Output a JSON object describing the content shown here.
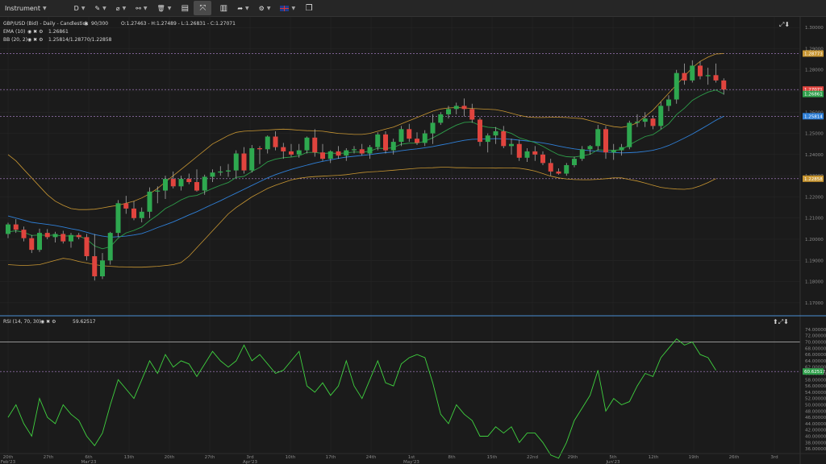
{
  "toolbar": {
    "instrument_label": "Instrument",
    "timeframe": "D",
    "flag_icon": "uk-flag-icon"
  },
  "legend": {
    "title": "GBP/USD (Bid) - Daily - Candlestick",
    "bars": "90/300",
    "ohlc": "O:1.27463 - H:1.27489 - L:1.26831 - C:1.27071",
    "ema_label": "EMA (10)",
    "ema_value": "1.26861",
    "bb_label": "BB (20, 2)",
    "bb_value": "1.25814/1.28770/1.22858"
  },
  "rsi_legend": {
    "label": "RSI (14, 70, 30)",
    "value": "59.62517"
  },
  "price_axis": {
    "ticks": [
      "1.30000",
      "1.29000",
      "1.28000",
      "1.27000",
      "1.26000",
      "1.25000",
      "1.24000",
      "1.23000",
      "1.22000",
      "1.21000",
      "1.20000",
      "1.19000",
      "1.18000",
      "1.17000"
    ],
    "badges": [
      {
        "label": "1.28773",
        "color": "#c89632"
      },
      {
        "label": "1.27071",
        "color": "#e0443e"
      },
      {
        "label": "1.26861",
        "color": "#2e9e4a"
      },
      {
        "label": "1.25814",
        "color": "#2f7fd6"
      },
      {
        "label": "1.22858",
        "color": "#c89632"
      }
    ]
  },
  "rsi_axis": {
    "ticks": [
      "74.00000",
      "72.00000",
      "70.00000",
      "68.00000",
      "66.00000",
      "64.00000",
      "62.00000",
      "60.00000",
      "58.00000",
      "56.00000",
      "54.00000",
      "52.00000",
      "50.00000",
      "48.00000",
      "46.00000",
      "44.00000",
      "42.00000",
      "40.00000",
      "38.00000",
      "36.00000"
    ],
    "badge": {
      "label": "60.62517",
      "color": "#2e9e4a"
    }
  },
  "dates": [
    {
      "label": "20th",
      "sub": "Feb'23"
    },
    {
      "label": "27th",
      "sub": ""
    },
    {
      "label": "6th",
      "sub": "Mar'23"
    },
    {
      "label": "13th",
      "sub": ""
    },
    {
      "label": "20th",
      "sub": ""
    },
    {
      "label": "27th",
      "sub": ""
    },
    {
      "label": "3rd",
      "sub": "Apr'23"
    },
    {
      "label": "10th",
      "sub": ""
    },
    {
      "label": "17th",
      "sub": ""
    },
    {
      "label": "24th",
      "sub": ""
    },
    {
      "label": "1st",
      "sub": "May'23"
    },
    {
      "label": "8th",
      "sub": ""
    },
    {
      "label": "15th",
      "sub": ""
    },
    {
      "label": "22nd",
      "sub": ""
    },
    {
      "label": "29th",
      "sub": ""
    },
    {
      "label": "5th",
      "sub": "Jun'23"
    },
    {
      "label": "12th",
      "sub": ""
    },
    {
      "label": "19th",
      "sub": ""
    },
    {
      "label": "26th",
      "sub": ""
    },
    {
      "label": "3rd",
      "sub": ""
    }
  ],
  "colors": {
    "up": "#2ea84f",
    "down": "#e0443e",
    "ema": "#2e9e4a",
    "bb_mid": "#2f7fd6",
    "bb_band": "#c89632",
    "rsi": "#3fd13f",
    "bg": "#1b1b1b"
  },
  "chart_data": {
    "type": "candlestick",
    "title": "GBP/USD (Bid) - Daily - Candlestick",
    "ylim": [
      1.165,
      1.305
    ],
    "candles": [
      [
        1.2025,
        1.2078,
        1.2005,
        1.207
      ],
      [
        1.207,
        1.2095,
        1.203,
        1.2045
      ],
      [
        1.2045,
        1.206,
        1.199,
        1.2005
      ],
      [
        1.2005,
        1.202,
        1.1935,
        1.195
      ],
      [
        1.195,
        1.205,
        1.194,
        1.203
      ],
      [
        1.203,
        1.2048,
        1.2,
        1.201
      ],
      [
        1.201,
        1.2035,
        1.1985,
        1.2025
      ],
      [
        1.2025,
        1.204,
        1.198,
        1.199
      ],
      [
        1.199,
        1.203,
        1.196,
        1.202
      ],
      [
        1.202,
        1.203,
        1.2,
        1.201
      ],
      [
        1.201,
        1.2025,
        1.19,
        1.192
      ],
      [
        1.192,
        1.2025,
        1.1805,
        1.1825
      ],
      [
        1.1825,
        1.1935,
        1.1812,
        1.19
      ],
      [
        1.19,
        1.2035,
        1.188,
        1.203
      ],
      [
        1.203,
        1.2185,
        1.201,
        1.217
      ],
      [
        1.217,
        1.2205,
        1.212,
        1.2145
      ],
      [
        1.2145,
        1.218,
        1.209,
        1.21
      ],
      [
        1.21,
        1.215,
        1.208,
        1.213
      ],
      [
        1.213,
        1.2245,
        1.21,
        1.2225
      ],
      [
        1.2225,
        1.225,
        1.217,
        1.223
      ],
      [
        1.223,
        1.23,
        1.219,
        1.2285
      ],
      [
        1.2285,
        1.232,
        1.224,
        1.225
      ],
      [
        1.225,
        1.23,
        1.223,
        1.2285
      ],
      [
        1.2285,
        1.231,
        1.226,
        1.227
      ],
      [
        1.227,
        1.233,
        1.2225,
        1.223
      ],
      [
        1.223,
        1.2305,
        1.221,
        1.2295
      ],
      [
        1.2295,
        1.233,
        1.227,
        1.2315
      ],
      [
        1.2315,
        1.2345,
        1.23,
        1.232
      ],
      [
        1.232,
        1.2355,
        1.2295,
        1.2325
      ],
      [
        1.2325,
        1.242,
        1.229,
        1.2405
      ],
      [
        1.2405,
        1.2435,
        1.231,
        1.2325
      ],
      [
        1.2325,
        1.2445,
        1.2315,
        1.243
      ],
      [
        1.243,
        1.244,
        1.2355,
        1.2425
      ],
      [
        1.2425,
        1.249,
        1.2405,
        1.2485
      ],
      [
        1.2485,
        1.251,
        1.242,
        1.2435
      ],
      [
        1.2435,
        1.2455,
        1.238,
        1.2415
      ],
      [
        1.2415,
        1.245,
        1.239,
        1.24
      ],
      [
        1.24,
        1.245,
        1.2385,
        1.242
      ],
      [
        1.242,
        1.2485,
        1.2405,
        1.248
      ],
      [
        1.248,
        1.252,
        1.239,
        1.241
      ],
      [
        1.241,
        1.245,
        1.237,
        1.238
      ],
      [
        1.238,
        1.242,
        1.236,
        1.2415
      ],
      [
        1.2415,
        1.244,
        1.238,
        1.2395
      ],
      [
        1.2395,
        1.243,
        1.237,
        1.242
      ],
      [
        1.242,
        1.244,
        1.2405,
        1.2425
      ],
      [
        1.2425,
        1.245,
        1.2395,
        1.2405
      ],
      [
        1.2405,
        1.2445,
        1.238,
        1.2435
      ],
      [
        1.2435,
        1.2505,
        1.242,
        1.2495
      ],
      [
        1.2495,
        1.251,
        1.2405,
        1.242
      ],
      [
        1.242,
        1.2475,
        1.24,
        1.246
      ],
      [
        1.246,
        1.2535,
        1.244,
        1.252
      ],
      [
        1.252,
        1.2545,
        1.246,
        1.2475
      ],
      [
        1.2475,
        1.2505,
        1.2445,
        1.2455
      ],
      [
        1.2455,
        1.2515,
        1.244,
        1.25
      ],
      [
        1.25,
        1.259,
        1.245,
        1.255
      ],
      [
        1.255,
        1.26,
        1.254,
        1.259
      ],
      [
        1.259,
        1.263,
        1.257,
        1.2615
      ],
      [
        1.2615,
        1.2645,
        1.259,
        1.263
      ],
      [
        1.263,
        1.2665,
        1.258,
        1.2615
      ],
      [
        1.2615,
        1.264,
        1.255,
        1.2565
      ],
      [
        1.2565,
        1.2575,
        1.244,
        1.246
      ],
      [
        1.246,
        1.25,
        1.241,
        1.249
      ],
      [
        1.249,
        1.253,
        1.245,
        1.251
      ],
      [
        1.251,
        1.2535,
        1.243,
        1.244
      ],
      [
        1.244,
        1.2475,
        1.24,
        1.245
      ],
      [
        1.245,
        1.247,
        1.237,
        1.2385
      ],
      [
        1.2385,
        1.243,
        1.2365,
        1.2415
      ],
      [
        1.2415,
        1.244,
        1.237,
        1.24
      ],
      [
        1.24,
        1.2415,
        1.235,
        1.236
      ],
      [
        1.236,
        1.238,
        1.23,
        1.232
      ],
      [
        1.232,
        1.2335,
        1.2305,
        1.231
      ],
      [
        1.231,
        1.236,
        1.23,
        1.235
      ],
      [
        1.235,
        1.239,
        1.234,
        1.238
      ],
      [
        1.238,
        1.244,
        1.237,
        1.2425
      ],
      [
        1.2425,
        1.2445,
        1.24,
        1.244
      ],
      [
        1.244,
        1.254,
        1.242,
        1.252
      ],
      [
        1.252,
        1.2535,
        1.238,
        1.241
      ],
      [
        1.241,
        1.245,
        1.2375,
        1.242
      ],
      [
        1.242,
        1.245,
        1.2395,
        1.2435
      ],
      [
        1.2435,
        1.256,
        1.2425,
        1.255
      ],
      [
        1.255,
        1.259,
        1.253,
        1.2555
      ],
      [
        1.2555,
        1.26,
        1.253,
        1.257
      ],
      [
        1.257,
        1.2585,
        1.252,
        1.2535
      ],
      [
        1.2535,
        1.265,
        1.252,
        1.263
      ],
      [
        1.263,
        1.268,
        1.2605,
        1.266
      ],
      [
        1.266,
        1.28,
        1.264,
        1.2785
      ],
      [
        1.2785,
        1.283,
        1.273,
        1.275
      ],
      [
        1.275,
        1.2845,
        1.274,
        1.282
      ],
      [
        1.282,
        1.284,
        1.2755,
        1.277
      ],
      [
        1.277,
        1.281,
        1.273,
        1.2775
      ],
      [
        1.2775,
        1.283,
        1.274,
        1.275
      ],
      [
        1.275,
        1.276,
        1.2683,
        1.2707
      ]
    ],
    "rsi": [
      46,
      50,
      44,
      40,
      52,
      46,
      44,
      50,
      47,
      45,
      40,
      37,
      41,
      50,
      58,
      55,
      52,
      58,
      64,
      60,
      66,
      62,
      64,
      63,
      59,
      63,
      67,
      64,
      62,
      64,
      69,
      64,
      66,
      63,
      60,
      61,
      64,
      67,
      56,
      54,
      57,
      53,
      56,
      64,
      56,
      52,
      58,
      64,
      57,
      56,
      63,
      65,
      66,
      65,
      57,
      47,
      44,
      50,
      47,
      45,
      40,
      40,
      43,
      41,
      43,
      38,
      41,
      41,
      38,
      34,
      33,
      38,
      45,
      49,
      53,
      61,
      48,
      52,
      50,
      51,
      56,
      60,
      59,
      65,
      68,
      71,
      69,
      70,
      66,
      65,
      61
    ],
    "ema": [
      1.2035,
      1.204,
      1.2033,
      1.2018,
      1.202,
      1.2018,
      1.202,
      1.2015,
      1.2016,
      1.2015,
      1.2,
      1.1968,
      1.1955,
      1.1965,
      1.2005,
      1.203,
      1.2042,
      1.2058,
      1.2088,
      1.2114,
      1.2145,
      1.2164,
      1.2186,
      1.2202,
      1.2207,
      1.2223,
      1.224,
      1.2255,
      1.2268,
      1.2292,
      1.2297,
      1.232,
      1.2339,
      1.2366,
      1.2378,
      1.2385,
      1.2388,
      1.2394,
      1.241,
      1.241,
      1.2405,
      1.2407,
      1.2405,
      1.2408,
      1.2412,
      1.2411,
      1.2416,
      1.243,
      1.2428,
      1.2433,
      1.2449,
      1.2454,
      1.2454,
      1.2463,
      1.2479,
      1.2499,
      1.252,
      1.2539,
      1.2552,
      1.2554,
      1.2537,
      1.2529,
      1.2526,
      1.2511,
      1.25,
      1.2479,
      1.2468,
      1.2456,
      1.2439,
      1.2418,
      1.2399,
      1.239,
      1.2388,
      1.2394,
      1.2401,
      1.2423,
      1.242,
      1.242,
      1.2423,
      1.2446,
      1.2466,
      1.2485,
      1.2494,
      1.2519,
      1.2545,
      1.2589,
      1.2619,
      1.2656,
      1.2677,
      1.2695,
      1.2705,
      1.2686
    ],
    "bb_mid": [
      1.211,
      1.21,
      1.209,
      1.208,
      1.2075,
      1.207,
      1.2065,
      1.2058,
      1.205,
      1.2043,
      1.2033,
      1.2022,
      1.2015,
      1.201,
      1.2012,
      1.2015,
      1.202,
      1.2027,
      1.204,
      1.2055,
      1.2068,
      1.2082,
      1.2098,
      1.2115,
      1.213,
      1.2148,
      1.2165,
      1.2182,
      1.22,
      1.2218,
      1.2236,
      1.2254,
      1.2272,
      1.229,
      1.2305,
      1.2318,
      1.233,
      1.234,
      1.235,
      1.236,
      1.2368,
      1.2375,
      1.2382,
      1.2388,
      1.2392,
      1.2396,
      1.24,
      1.2405,
      1.2409,
      1.2412,
      1.2418,
      1.2423,
      1.2427,
      1.2432,
      1.2438,
      1.2445,
      1.2452,
      1.246,
      1.2467,
      1.2472,
      1.2473,
      1.2474,
      1.2475,
      1.2474,
      1.2472,
      1.2468,
      1.2464,
      1.246,
      1.2455,
      1.2448,
      1.244,
      1.2433,
      1.2427,
      1.2422,
      1.2418,
      1.2416,
      1.2412,
      1.241,
      1.2408,
      1.2409,
      1.2411,
      1.2415,
      1.242,
      1.243,
      1.2443,
      1.246,
      1.2478,
      1.2497,
      1.2518,
      1.254,
      1.2562,
      1.2581
    ],
    "bb_up": [
      1.24,
      1.237,
      1.233,
      1.229,
      1.225,
      1.221,
      1.218,
      1.216,
      1.2145,
      1.214,
      1.214,
      1.2142,
      1.2148,
      1.2155,
      1.216,
      1.217,
      1.218,
      1.2195,
      1.2215,
      1.224,
      1.227,
      1.23,
      1.233,
      1.236,
      1.239,
      1.242,
      1.245,
      1.247,
      1.249,
      1.2505,
      1.251,
      1.2512,
      1.2514,
      1.2516,
      1.2518,
      1.252,
      1.2518,
      1.2515,
      1.2513,
      1.2512,
      1.251,
      1.2505,
      1.25,
      1.2498,
      1.2495,
      1.2495,
      1.25,
      1.251,
      1.252,
      1.253,
      1.2545,
      1.256,
      1.2575,
      1.259,
      1.2605,
      1.2615,
      1.262,
      1.2622,
      1.262,
      1.2618,
      1.2616,
      1.2614,
      1.2612,
      1.2605,
      1.2595,
      1.2585,
      1.2578,
      1.2575,
      1.2575,
      1.2576,
      1.2576,
      1.2575,
      1.2572,
      1.257,
      1.256,
      1.255,
      1.254,
      1.2532,
      1.2528,
      1.2535,
      1.255,
      1.258,
      1.261,
      1.265,
      1.269,
      1.273,
      1.277,
      1.281,
      1.284,
      1.286,
      1.2875,
      1.2877
    ],
    "bb_low": [
      1.188,
      1.1878,
      1.1876,
      1.1878,
      1.188,
      1.189,
      1.19,
      1.191,
      1.1905,
      1.1895,
      1.1888,
      1.188,
      1.1875,
      1.1872,
      1.187,
      1.1869,
      1.1868,
      1.1868,
      1.187,
      1.1872,
      1.1876,
      1.188,
      1.189,
      1.192,
      1.196,
      1.2,
      1.204,
      1.208,
      1.212,
      1.215,
      1.2175,
      1.22,
      1.222,
      1.224,
      1.2255,
      1.2268,
      1.228,
      1.2288,
      1.2293,
      1.2296,
      1.2298,
      1.23,
      1.2302,
      1.2305,
      1.231,
      1.2315,
      1.2318,
      1.232,
      1.2323,
      1.2326,
      1.2329,
      1.2332,
      1.2335,
      1.2337,
      1.2338,
      1.234,
      1.234,
      1.2338,
      1.2338,
      1.2337,
      1.2337,
      1.2337,
      1.2336,
      1.2337,
      1.2337,
      1.2335,
      1.233,
      1.2322,
      1.231,
      1.2298,
      1.229,
      1.2285,
      1.2282,
      1.2281,
      1.2281,
      1.2283,
      1.2286,
      1.229,
      1.229,
      1.2282,
      1.2275,
      1.2265,
      1.2255,
      1.2245,
      1.224,
      1.2237,
      1.2236,
      1.224,
      1.2252,
      1.2268,
      1.2286
    ]
  }
}
